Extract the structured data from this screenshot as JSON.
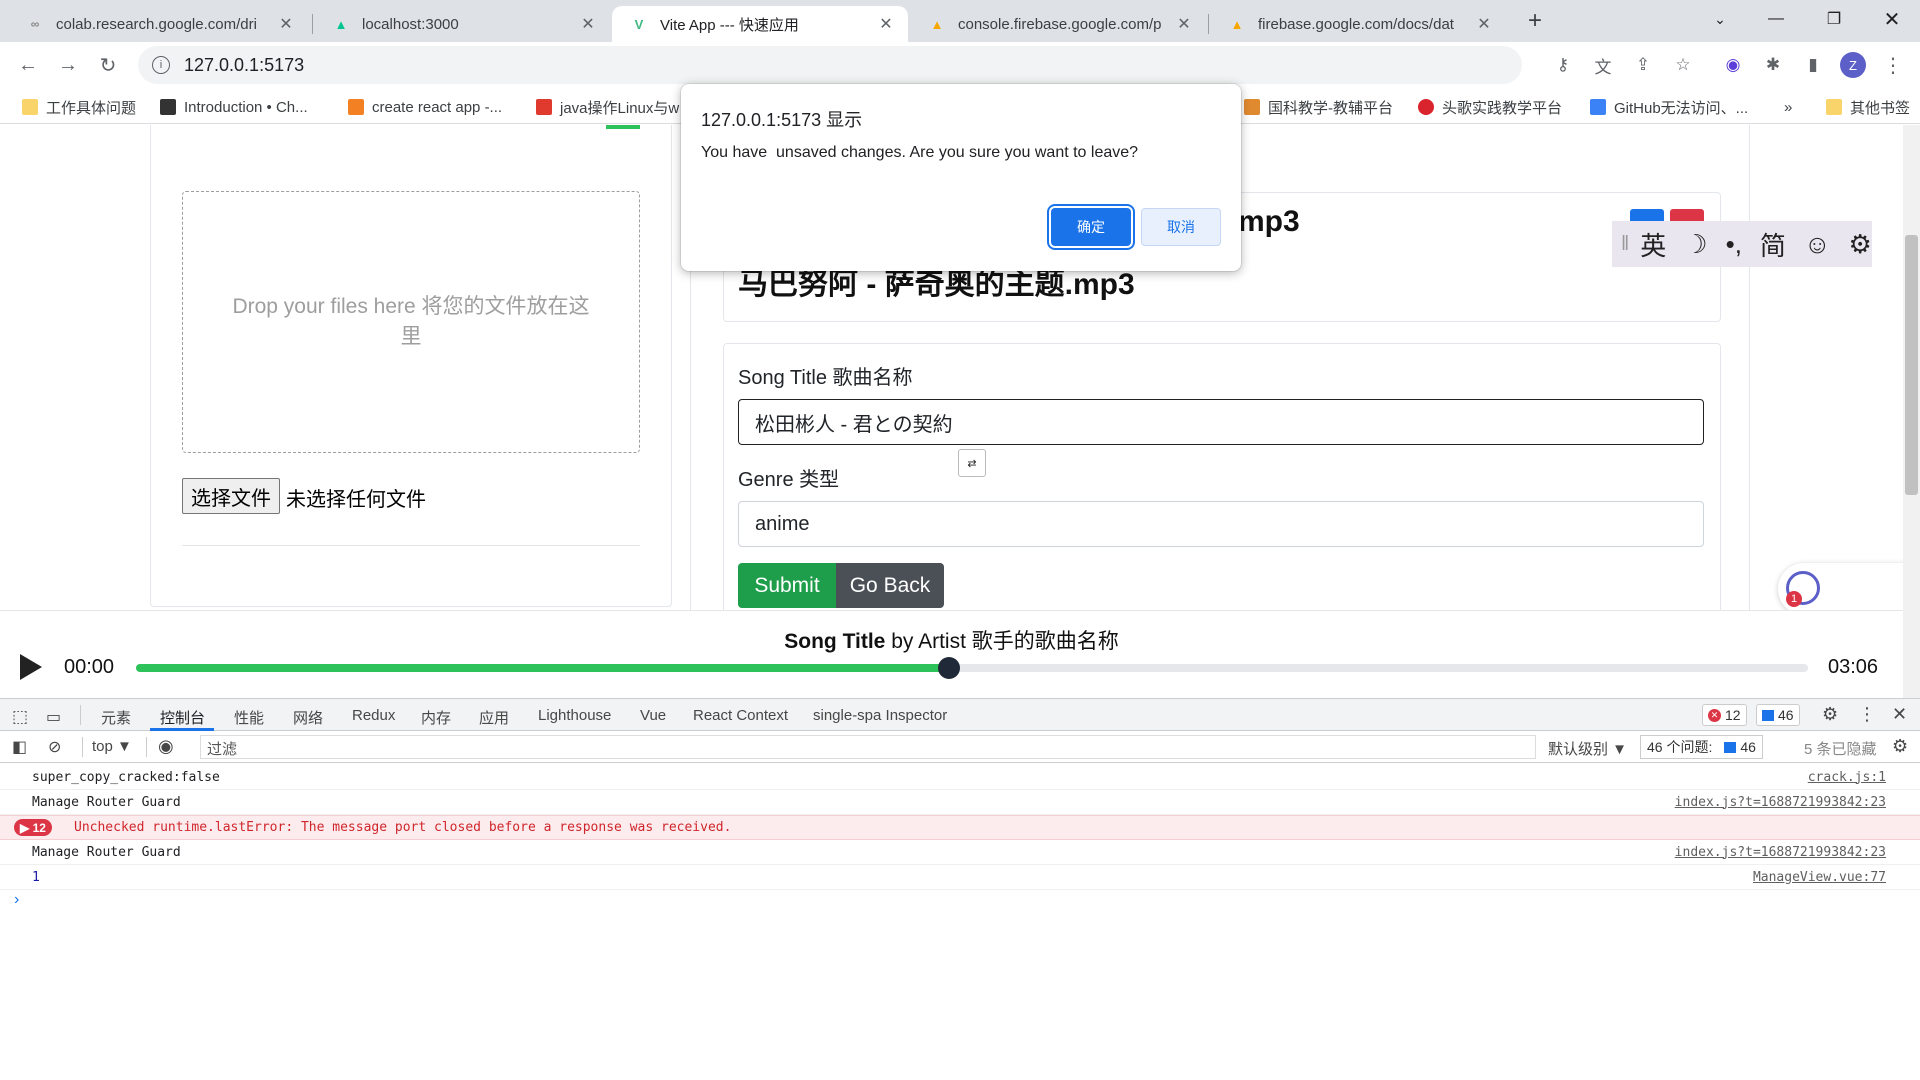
{
  "browser": {
    "tabs": [
      {
        "title": "colab.research.google.com/dri",
        "icon": "colab-icon"
      },
      {
        "title": "localhost:3000",
        "icon": "nuxt-icon"
      },
      {
        "title": "Vite App --- 快速应用",
        "icon": "vue-icon"
      },
      {
        "title": "console.firebase.google.com/p",
        "icon": "firebase-icon"
      },
      {
        "title": "firebase.google.com/docs/dat",
        "icon": "firebase-icon"
      }
    ],
    "url": "127.0.0.1:5173",
    "profile_initial": "Z",
    "bookmarks": [
      "工作具体问题",
      "Introduction • Ch...",
      "create react app -...",
      "java操作Linux与w",
      "国科教学-教辅平台",
      "头歌实践教学平台",
      "GitHub无法访问、...",
      "»",
      "其他书签"
    ]
  },
  "page": {
    "dropzone_text": "Drop your files here 将您的文件放在这里",
    "file_button": "选择文件",
    "file_status": "未选择任何文件",
    "song_heading_partial": "mp3",
    "song_heading": "马巴努阿 - 萨奇奥的主题.mp3",
    "form": {
      "title_label": "Song Title 歌曲名称",
      "title_value": "松田彬人 - 君との契約",
      "genre_label": "Genre 类型",
      "genre_value": "anime",
      "submit": "Submit",
      "back": "Go Back"
    },
    "ime": [
      "英",
      "☽",
      "•,",
      "简",
      "☺",
      "⚙"
    ],
    "widget_badge": "1"
  },
  "player": {
    "song_title": "Song Title",
    "by_text": "by Artist 歌手的歌曲名称",
    "current_time": "00:00",
    "duration": "03:06",
    "progress": 0.4865
  },
  "devtools": {
    "tabs": [
      "元素",
      "控制台",
      "性能",
      "网络",
      "Redux",
      "内存",
      "应用",
      "Lighthouse",
      "Vue",
      "React Context",
      "single-spa Inspector"
    ],
    "error_badge": "12",
    "message_badge": "46",
    "context": "top",
    "filter_placeholder": "过滤",
    "level": "默认级别",
    "issues_label": "46 个问题:",
    "issues_count": "46",
    "hidden": "5 条已隐藏",
    "console": [
      {
        "msg": "super_copy_cracked:false",
        "src": "crack.js:1",
        "type": "log"
      },
      {
        "msg": "Manage Router Guard",
        "src": "index.js?t=1688721993842:23",
        "type": "log"
      },
      {
        "msg": "Unchecked runtime.lastError: The message port closed before a response was received.",
        "src": "",
        "type": "error",
        "count": "12"
      },
      {
        "msg": "Manage Router Guard",
        "src": "index.js?t=1688721993842:23",
        "type": "log"
      },
      {
        "msg": "1",
        "src": "ManageView.vue:77",
        "type": "log"
      }
    ],
    "prompt": "›"
  },
  "alert": {
    "title": "127.0.0.1:5173 显示",
    "message": "You have  unsaved changes. Are you sure you want to leave?",
    "ok": "确定",
    "cancel": "取消"
  },
  "colors": {
    "submit": "#1e9e4a",
    "go_back": "#4a5056",
    "progress_fill": "#2dc25a",
    "link_blue": "#1a73e8",
    "error_red": "#dc3545"
  }
}
